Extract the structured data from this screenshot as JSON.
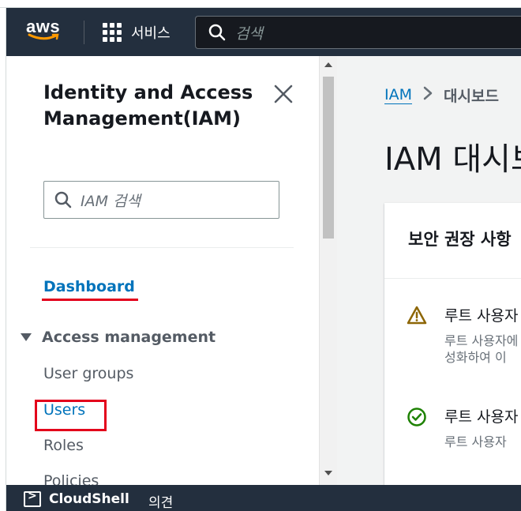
{
  "topnav": {
    "logo_text": "aws",
    "services_label": "서비스",
    "search_placeholder": "검색"
  },
  "sidenav": {
    "title": "Identity and Access Management(IAM)",
    "search_placeholder": "IAM 검색",
    "dashboard_label": "Dashboard",
    "section_label": "Access management",
    "items": [
      {
        "label": "User groups"
      },
      {
        "label": "Users"
      },
      {
        "label": "Roles"
      },
      {
        "label": "Policies"
      }
    ]
  },
  "main": {
    "breadcrumb": {
      "root": "IAM",
      "current": "대시보드"
    },
    "page_title": "IAM 대시보드",
    "card_title": "보안 권장 사항",
    "recommendations": [
      {
        "title": "루트 사용자",
        "desc_line1": "루트 사용자에",
        "desc_line2": "성화하여 이",
        "status": "warning"
      },
      {
        "title": "루트 사용자",
        "desc_line1": "루트 사용자",
        "status": "success"
      }
    ]
  },
  "bottombar": {
    "cloudshell_label": "CloudShell",
    "feedback_label": "의견"
  },
  "colors": {
    "nav_bg": "#232f3e",
    "link": "#0073bb",
    "highlight": "#e3001b",
    "warning": "#8d6605",
    "success": "#1d8102"
  }
}
